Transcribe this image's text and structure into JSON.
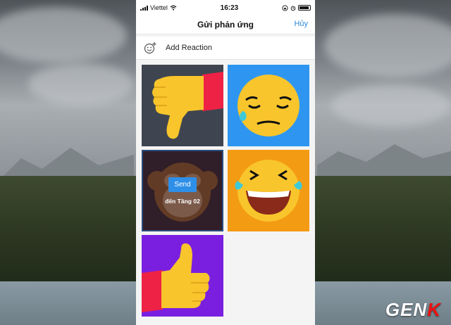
{
  "status_bar": {
    "carrier": "Viettel",
    "time": "16:23"
  },
  "header": {
    "title": "Gửi phản ứng",
    "cancel_label": "Hủy"
  },
  "add_reaction": {
    "label": "Add Reaction",
    "icon": "smiley-plus-icon"
  },
  "reactions": [
    {
      "icon": "thumbs-down-icon",
      "bg": "#3f4550"
    },
    {
      "icon": "sad-face-icon",
      "bg": "#2e96f0"
    },
    {
      "icon": "monkey-face-icon",
      "bg": "#3a2a30",
      "selected": true
    },
    {
      "icon": "laughing-tears-icon",
      "bg": "#f49b14"
    },
    {
      "icon": "thumbs-up-icon",
      "bg": "#7a1fe0"
    }
  ],
  "selected_overlay": {
    "send_label": "Send",
    "destination": "đến Tầng 02"
  },
  "watermark": {
    "text_left": "GEN",
    "text_right": "K"
  },
  "colors": {
    "accent": "#2e8fe8",
    "emoji_yellow": "#f8c52c",
    "cuff_red": "#ee2244"
  }
}
